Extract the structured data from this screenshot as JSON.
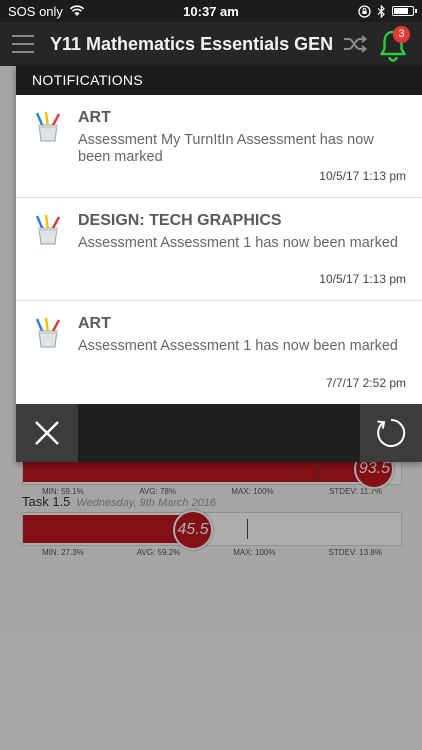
{
  "status_bar": {
    "carrier": "SOS only",
    "time": "10:37 am",
    "battery_level": 0.85
  },
  "header": {
    "title": "Y11 Mathematics Essentials GEN",
    "notification_count": "3",
    "icons": [
      "menu-icon",
      "shuffle-icon",
      "bell-icon"
    ],
    "accent_color": "#2ecc40"
  },
  "notifications": {
    "heading": "NOTIFICATIONS",
    "items": [
      {
        "subject": "ART",
        "message": "Assessment My TurnItIn Assessment has now been marked",
        "time": "10/5/17 1:13 pm"
      },
      {
        "subject": "DESIGN: TECH GRAPHICS",
        "message": "Assessment Assessment 1 has now been marked",
        "time": "10/5/17 1:13 pm"
      },
      {
        "subject": "ART",
        "message": "Assessment Assessment 1 has now been marked",
        "time": "7/7/17 2:52 pm"
      }
    ],
    "icons": [
      "close-icon",
      "refresh-icon"
    ]
  },
  "background": {
    "tasks": [
      {
        "score_label": "93.5",
        "score_pct": 0.935,
        "avg_pct": 0.78,
        "stats": {
          "min": "MIN: 59.1%",
          "avg": "AVG: 78%",
          "max": "MAX: 100%",
          "stdev": "STDEV: 11.7%"
        }
      },
      {
        "name": "Task 1.5",
        "date": "Wednesday, 9th March 2016",
        "score_label": "45.5",
        "score_pct": 0.455,
        "avg_pct": 0.592,
        "stats": {
          "min": "MIN: 27.3%",
          "avg": "AVG: 59.2%",
          "max": "MAX: 100%",
          "stdev": "STDEV: 13.8%"
        }
      }
    ],
    "bar_color": "#c2181f"
  }
}
